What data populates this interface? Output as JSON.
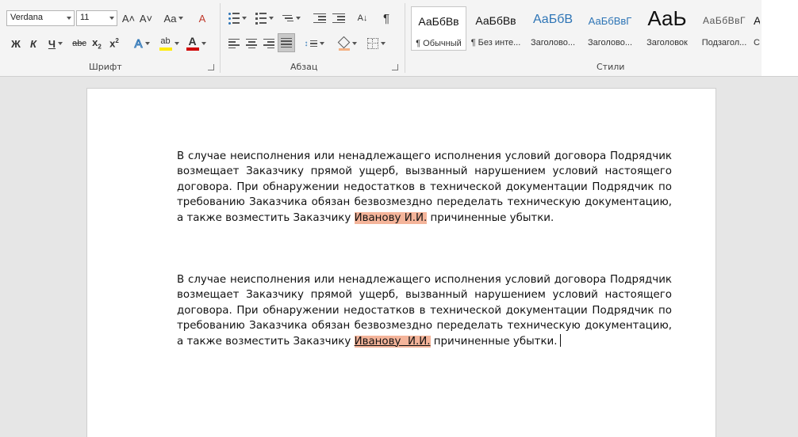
{
  "font": {
    "family": "Verdana",
    "size": "11",
    "grow_glyph": "A˄",
    "shrink_glyph": "A˅",
    "case_label": "Aa",
    "clear_glyph": "A",
    "bold": "Ж",
    "italic": "К",
    "underline": "Ч",
    "strike": "abc",
    "sub_base": "x",
    "sub_mark": "2",
    "sup_base": "x",
    "sup_mark": "2",
    "effects_glyph": "A",
    "highlight_glyph": "ab",
    "color_glyph": "A",
    "group_label": "Шрифт",
    "highlight_color": "#ffeb00",
    "font_color": "#d00000"
  },
  "paragraph": {
    "group_label": "Абзац",
    "sort_glyph": "A↓",
    "pilcrow": "¶"
  },
  "styles": {
    "group_label": "Стили",
    "items": [
      {
        "sample": "АаБбВв",
        "name": "¶ Обычный"
      },
      {
        "sample": "АаБбВв",
        "name": "¶ Без инте..."
      },
      {
        "sample": "АаБбВ",
        "name": "Заголово..."
      },
      {
        "sample": "АаБбВвГ",
        "name": "Заголово..."
      },
      {
        "sample": "АаЬ",
        "name": "Заголовок"
      },
      {
        "sample": "АаБбВвГ",
        "name": "Подзагол..."
      },
      {
        "sample": "A",
        "name": "C"
      }
    ]
  },
  "document": {
    "p1": {
      "text": "В случае неисполнения или ненадлежащего исполнения условий договора Подрядчик возмещает Заказчику прямой ущерб, вызванный нарушением условий настоящего договора. При обнаружении недостатков в технической документации Подрядчик по требованию Заказчика обязан безвозмездно переделать техническую документацию, а также возместить Заказчику ",
      "highlight": "Иванову И.И.",
      "tail": " причиненные убытки."
    },
    "p2": {
      "text": "В случае неисполнения или ненадлежащего исполнения условий договора Подрядчик возмещает Заказчику прямой ущерб, вызванный нарушением условий настоящего договора. При обнаружении недостатков в технической документации Подрядчик по требованию Заказчика обязан безвозмездно переделать техническую документацию, а также возместить Заказчику ",
      "highlight": "Иванову  И.И.",
      "tail": " причиненные убытки."
    },
    "highlight_color": "#f4b49a"
  }
}
